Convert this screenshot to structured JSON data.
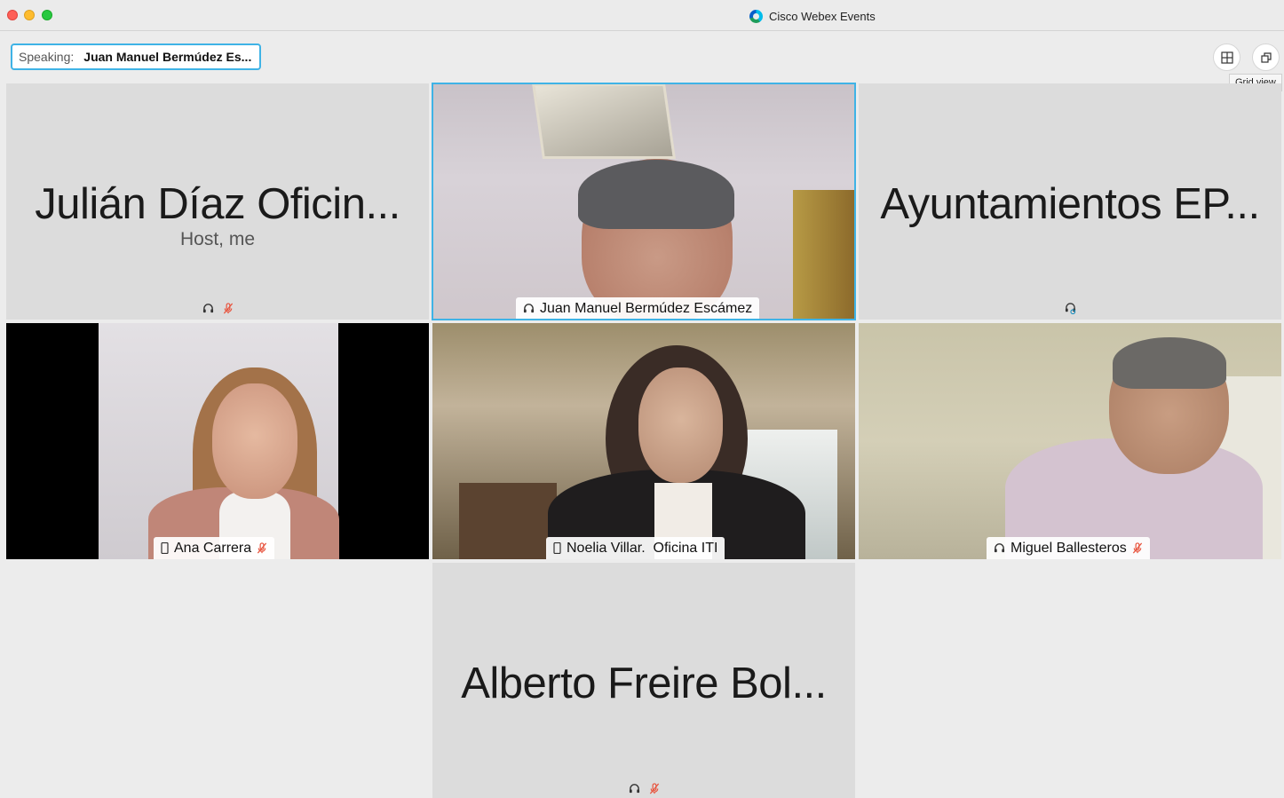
{
  "window": {
    "title": "Cisco Webex Events"
  },
  "speaking": {
    "label": "Speaking:",
    "name": "Juan Manuel Bermúdez Es..."
  },
  "toolbar": {
    "tooltip": "Grid view"
  },
  "participants": [
    {
      "display_name": "Julián Díaz Oficin...",
      "subtitle": "Host, me",
      "video": false,
      "muted": true,
      "audio": "headset"
    },
    {
      "display_name": "Juan Manuel Bermúdez Escámez",
      "video": true,
      "active_speaker": true,
      "audio": "headset"
    },
    {
      "display_name": "Ayuntamientos EP...",
      "video": false,
      "audio": "computer"
    },
    {
      "display_name": "Ana Carrera",
      "video": true,
      "muted": true,
      "audio": "phone"
    },
    {
      "display_name": "Noelia Villar.  Oficina ITI",
      "video": true,
      "audio": "phone"
    },
    {
      "display_name": "Miguel Ballesteros",
      "video": true,
      "muted": true,
      "audio": "headset"
    },
    {
      "display_name": "Alberto Freire Bol...",
      "video": false,
      "muted": true,
      "audio": "headset"
    }
  ],
  "colors": {
    "active_border": "#3fb3e6",
    "muted_icon": "#e8543e"
  }
}
